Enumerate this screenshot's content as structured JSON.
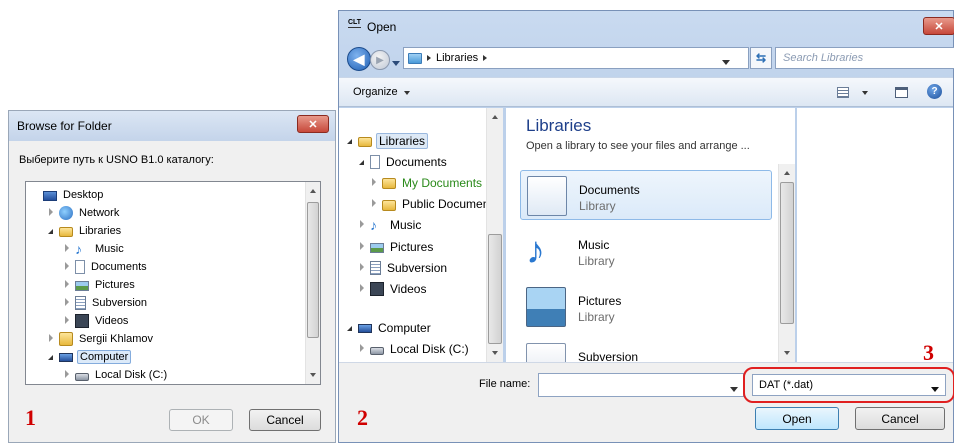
{
  "browse": {
    "title": "Browse for Folder",
    "prompt": "Выберите путь к USNO B1.0 каталогу:",
    "tree": [
      {
        "label": "Desktop",
        "icon": "desktop-icon",
        "depth": 0,
        "exp": "none"
      },
      {
        "label": "Network",
        "icon": "network-icon",
        "depth": 1,
        "exp": "closed"
      },
      {
        "label": "Libraries",
        "icon": "libraries-icon",
        "depth": 1,
        "exp": "open"
      },
      {
        "label": "Music",
        "icon": "music-icon",
        "depth": 2,
        "exp": "closed"
      },
      {
        "label": "Documents",
        "icon": "documents-icon",
        "depth": 2,
        "exp": "closed"
      },
      {
        "label": "Pictures",
        "icon": "pictures-icon",
        "depth": 2,
        "exp": "closed"
      },
      {
        "label": "Subversion",
        "icon": "subversion-icon",
        "depth": 2,
        "exp": "closed"
      },
      {
        "label": "Videos",
        "icon": "videos-icon",
        "depth": 2,
        "exp": "closed"
      },
      {
        "label": "Sergii Khlamov",
        "icon": "user-folder-icon",
        "depth": 1,
        "exp": "closed"
      },
      {
        "label": "Computer",
        "icon": "computer-icon",
        "depth": 1,
        "exp": "open",
        "selected": true
      },
      {
        "label": "Local Disk (C:)",
        "icon": "local-disk-icon",
        "depth": 2,
        "exp": "closed"
      }
    ],
    "ok_label": "OK",
    "cancel_label": "Cancel"
  },
  "open": {
    "title": "Open",
    "app_icon_text": "CLT",
    "breadcrumb": "Libraries",
    "search_placeholder": "Search Libraries",
    "organize_label": "Organize",
    "nav": [
      {
        "label": "Libraries",
        "icon": "libraries-icon",
        "depth": 0,
        "exp": "open",
        "selected": true
      },
      {
        "label": "Documents",
        "icon": "documents-icon",
        "depth": 1,
        "exp": "open"
      },
      {
        "label": "My Documents",
        "icon": "folder-icon",
        "depth": 2,
        "exp": "closed",
        "green": true
      },
      {
        "label": "Public Documents",
        "icon": "folder-icon",
        "depth": 2,
        "exp": "closed"
      },
      {
        "label": "Music",
        "icon": "music-icon",
        "depth": 1,
        "exp": "closed"
      },
      {
        "label": "Pictures",
        "icon": "pictures-icon",
        "depth": 1,
        "exp": "closed"
      },
      {
        "label": "Subversion",
        "icon": "subversion-icon",
        "depth": 1,
        "exp": "closed"
      },
      {
        "label": "Videos",
        "icon": "videos-icon",
        "depth": 1,
        "exp": "closed"
      },
      {
        "label": "Computer",
        "icon": "computer-icon",
        "depth": 0,
        "exp": "open",
        "gap": true
      },
      {
        "label": "Local Disk (C:)",
        "icon": "local-disk-icon",
        "depth": 1,
        "exp": "closed"
      }
    ],
    "content_title": "Libraries",
    "content_subtitle": "Open a library to see your files and arrange ...",
    "items": [
      {
        "name": "Documents",
        "type": "Library",
        "icon": "documents-library-icon",
        "selected": true
      },
      {
        "name": "Music",
        "type": "Library",
        "icon": "music-library-icon"
      },
      {
        "name": "Pictures",
        "type": "Library",
        "icon": "pictures-library-icon"
      },
      {
        "name": "Subversion",
        "type": "",
        "icon": "subversion-library-icon"
      }
    ],
    "filename_label": "File name:",
    "filename_value": "",
    "filetype_value": "DAT (*.dat)",
    "open_label": "Open",
    "cancel_label": "Cancel"
  },
  "markers": {
    "one": "1",
    "two": "2",
    "three": "3"
  },
  "colors": {
    "accent": "#3f6fb8",
    "marker": "#d00000",
    "close": "#c7483a",
    "green_text": "#2a8a1a"
  }
}
